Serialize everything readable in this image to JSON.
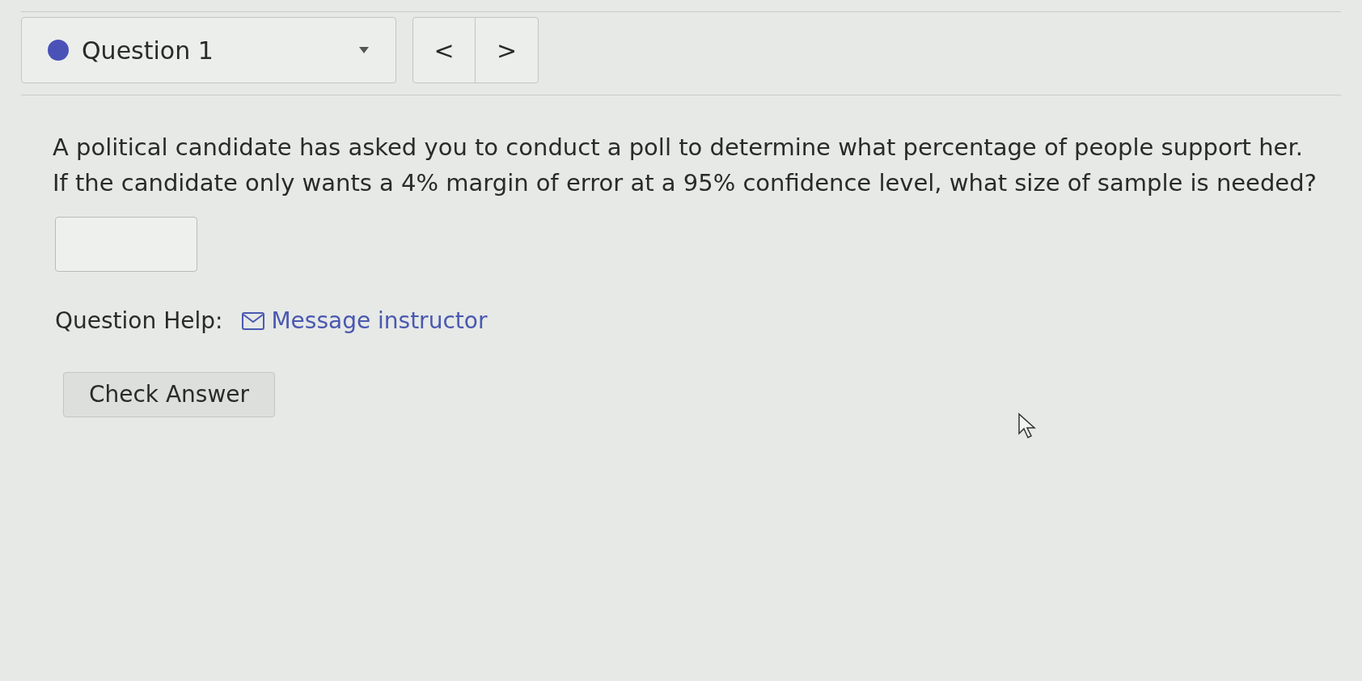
{
  "question_selector": {
    "label": "Question 1",
    "expanded": false
  },
  "navigation": {
    "previous": "<",
    "next": ">"
  },
  "question": {
    "lines": [
      "A political candidate has asked you to conduct a poll to determine what percentage of people support her.",
      "If the candidate only wants a 4% margin of error at a 95% confidence level, what size of sample is needed?"
    ]
  },
  "question_help": {
    "label": "Question Help:",
    "link": "Message instructor"
  },
  "check_button": "Check Answer"
}
